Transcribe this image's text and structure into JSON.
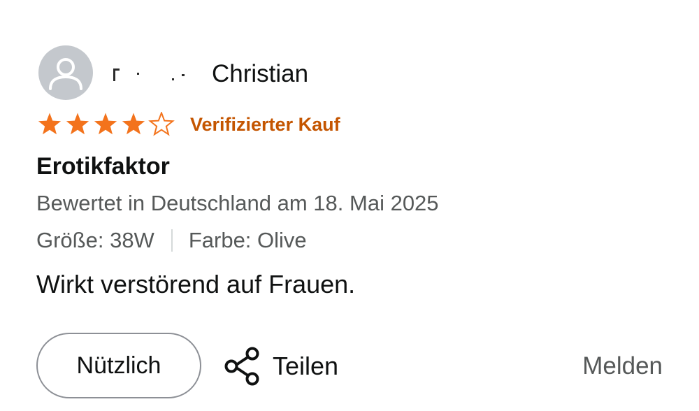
{
  "review": {
    "author": "Christian",
    "rating": 4,
    "rating_max": 5,
    "verified_label": "Verifizierter Kauf",
    "title": "Erotikfaktor",
    "date_text": "Bewertet in Deutschland am 18. Mai 2025",
    "size_text": "Größe: 38W",
    "color_text": "Farbe: Olive",
    "text": "Wirkt verstörend auf Frauen."
  },
  "actions": {
    "helpful_label": "Nützlich",
    "share_label": "Teilen",
    "report_label": "Melden"
  },
  "colors": {
    "star": "#f3731c",
    "verified": "#c45500",
    "avatar_bg": "#c4c8cd",
    "secondary_text": "#565959"
  },
  "icons": {
    "avatar": "user-silhouette-icon",
    "share": "share-nodes-icon",
    "star": "star-icon"
  }
}
